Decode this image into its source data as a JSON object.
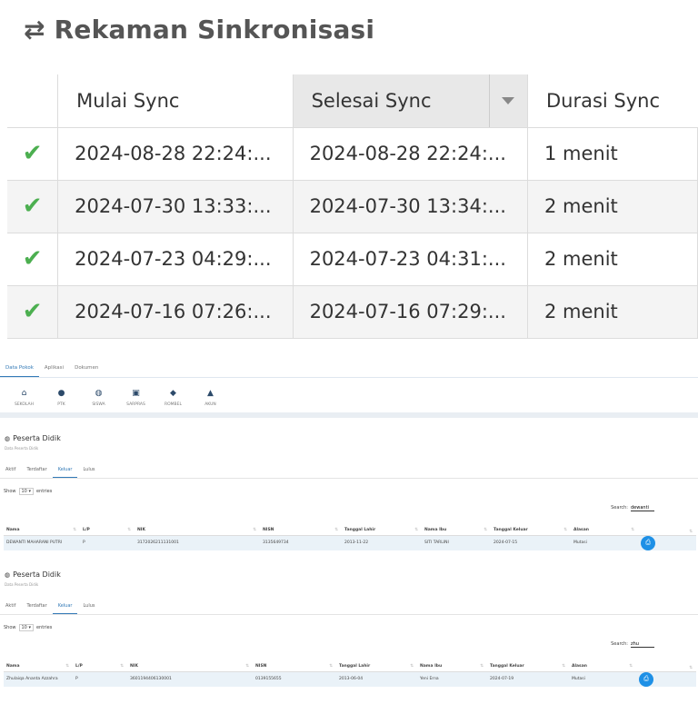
{
  "sync": {
    "title": "Rekaman Sinkronisasi",
    "title_icon": "⇄",
    "columns": {
      "start": "Mulai Sync",
      "end": "Selesai Sync",
      "duration": "Durasi Sync"
    },
    "rows": [
      {
        "start": "2024-08-28 22:24:...",
        "end": "2024-08-28 22:24:...",
        "duration": "1 menit"
      },
      {
        "start": "2024-07-30 13:33:...",
        "end": "2024-07-30 13:34:...",
        "duration": "2 menit"
      },
      {
        "start": "2024-07-23 04:29:...",
        "end": "2024-07-23 04:31:...",
        "duration": "2 menit"
      },
      {
        "start": "2024-07-16 07:26:...",
        "end": "2024-07-16 07:29:...",
        "duration": "2 menit"
      }
    ],
    "check_color": "#4caf50"
  },
  "app": {
    "top_tabs": [
      "Data Pokok",
      "Aplikasi",
      "Dokumen"
    ],
    "menu": [
      {
        "icon": "home-icon",
        "glyph": "⌂",
        "label": "SEKOLAH"
      },
      {
        "icon": "user-icon",
        "glyph": "●",
        "label": "PTK"
      },
      {
        "icon": "users-icon",
        "glyph": "◍",
        "label": "SISWA"
      },
      {
        "icon": "image-icon",
        "glyph": "▣",
        "label": "SARPRAS"
      },
      {
        "icon": "boxes-icon",
        "glyph": "◆",
        "label": "ROMBEL"
      },
      {
        "icon": "lock-icon",
        "glyph": "▲",
        "label": "AKUN"
      }
    ],
    "accent": "#337ab7"
  },
  "panels": [
    {
      "title": "Peserta Didik",
      "subtitle": "Data Peserta Didik",
      "tabs": [
        "Aktif",
        "Terdaftar",
        "Keluar",
        "Lulus"
      ],
      "active_tab": "Keluar",
      "show_label": "Show",
      "show_value": "10",
      "entries_label": "entries",
      "search_label": "Search:",
      "search_value": "dewanti",
      "headers": [
        "Nama",
        "L/P",
        "NIK",
        "NISN",
        "Tanggal Lahir",
        "Nama Ibu",
        "Tanggal Keluar",
        "Alasan"
      ],
      "row": [
        "DEWANTI MAHARANI PUTRI",
        "P",
        "3172026211131001",
        "3135649734",
        "2013-11-22",
        "SITI TARLINI",
        "2024-07-15",
        "Mutasi"
      ]
    },
    {
      "title": "Peserta Didik",
      "subtitle": "Data Peserta Didik",
      "tabs": [
        "Aktif",
        "Terdaftar",
        "Keluar",
        "Lulus"
      ],
      "active_tab": "Keluar",
      "show_label": "Show",
      "show_value": "10",
      "entries_label": "entries",
      "search_label": "Search:",
      "search_value": "zhu",
      "headers": [
        "Nama",
        "L/P",
        "NIK",
        "NISN",
        "Tanggal Lahir",
        "Nama Ibu",
        "Tanggal Keluar",
        "Alasan"
      ],
      "row": [
        "Zhulaiqa Ananta Azzahra",
        "P",
        "3601194406130001",
        "0139155655",
        "2013-06-04",
        "Yeni Erna",
        "2024-07-19",
        "Mutasi"
      ]
    }
  ]
}
